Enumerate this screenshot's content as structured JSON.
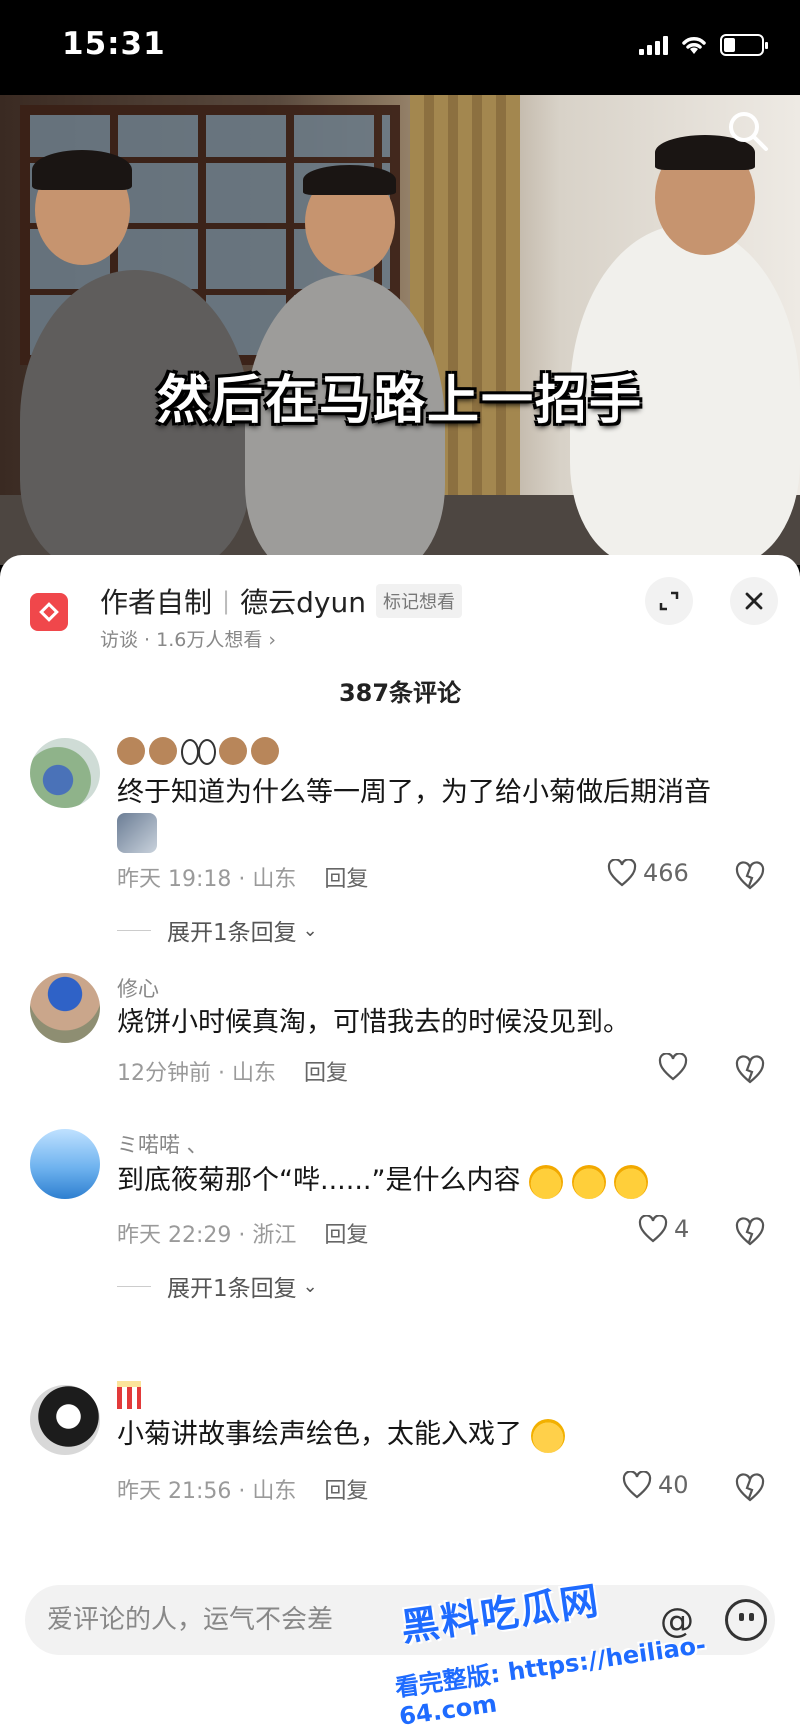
{
  "status_bar": {
    "time": "15:31"
  },
  "video": {
    "subtitle": "然后在马路上一招手"
  },
  "header": {
    "badge": "作者自制",
    "channel": "德云dyun",
    "mark_label": "标记想看",
    "sub": "访谈 · 1.6万人想看 ›"
  },
  "comment_count": "387条评论",
  "comments": [
    {
      "name": "",
      "text": "终于知道为什么等一周了，为了给小菊做后期消音",
      "time": "昨天 19:18 · 山东",
      "reply": "回复",
      "likes": "466",
      "expand": "展开1条回复"
    },
    {
      "name": "修心",
      "text": "烧饼小时候真淘，可惜我去的时候没见到。",
      "time": "12分钟前 · 山东",
      "reply": "回复",
      "likes": ""
    },
    {
      "name": "ミ喏喏 、",
      "text": "到底筱菊那个“哔......”是什么内容",
      "time": "昨天 22:29 · 浙江",
      "reply": "回复",
      "likes": "4",
      "expand": "展开1条回复"
    },
    {
      "name": "",
      "text": "小菊讲故事绘声绘色，太能入戏了",
      "time": "昨天 21:56 · 山东",
      "reply": "回复",
      "likes": "40"
    }
  ],
  "input": {
    "placeholder": "爱评论的人，运气不会差"
  },
  "watermark": {
    "title": "黑料吃瓜网",
    "url": "看完整版: https://heiliao-64.com"
  },
  "icons": [
    "search-icon",
    "expand-icon",
    "close-icon",
    "heart-icon",
    "dislike-icon",
    "at-icon",
    "emoji-icon"
  ],
  "colors": {
    "accent": "#f0474b",
    "watermark": "#1e6bff"
  }
}
